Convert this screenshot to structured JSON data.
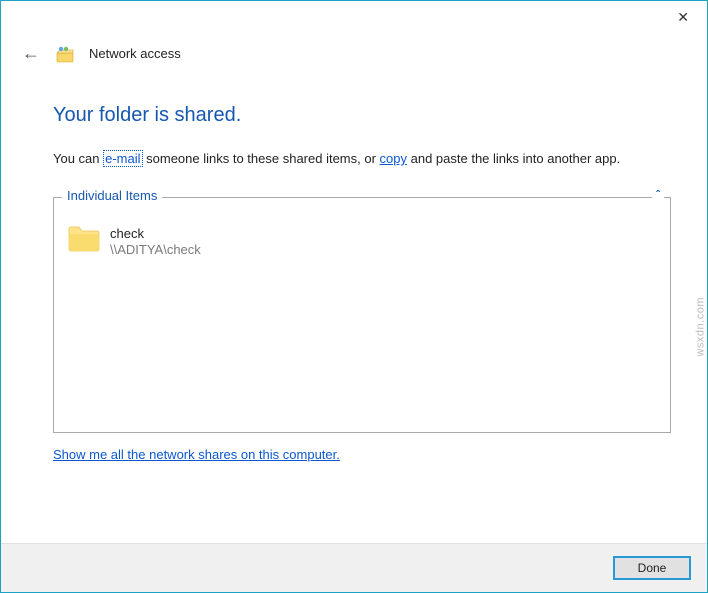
{
  "titlebar": {
    "close_glyph": "✕"
  },
  "header": {
    "back_glyph": "←",
    "title": "Network access"
  },
  "main": {
    "heading": "Your folder is shared.",
    "desc_pre": "You can ",
    "email_link": "e-mail",
    "desc_mid": " someone links to these shared items, or ",
    "copy_link": "copy",
    "desc_post": " and paste the links into another app."
  },
  "group": {
    "legend": "Individual Items",
    "caret": "ˆ",
    "items": [
      {
        "name": "check",
        "path": "\\\\ADITYA\\check"
      }
    ]
  },
  "bottom_link": "Show me all the network shares on this computer.",
  "footer": {
    "done_label": "Done"
  },
  "watermark": "wsxdn.com"
}
